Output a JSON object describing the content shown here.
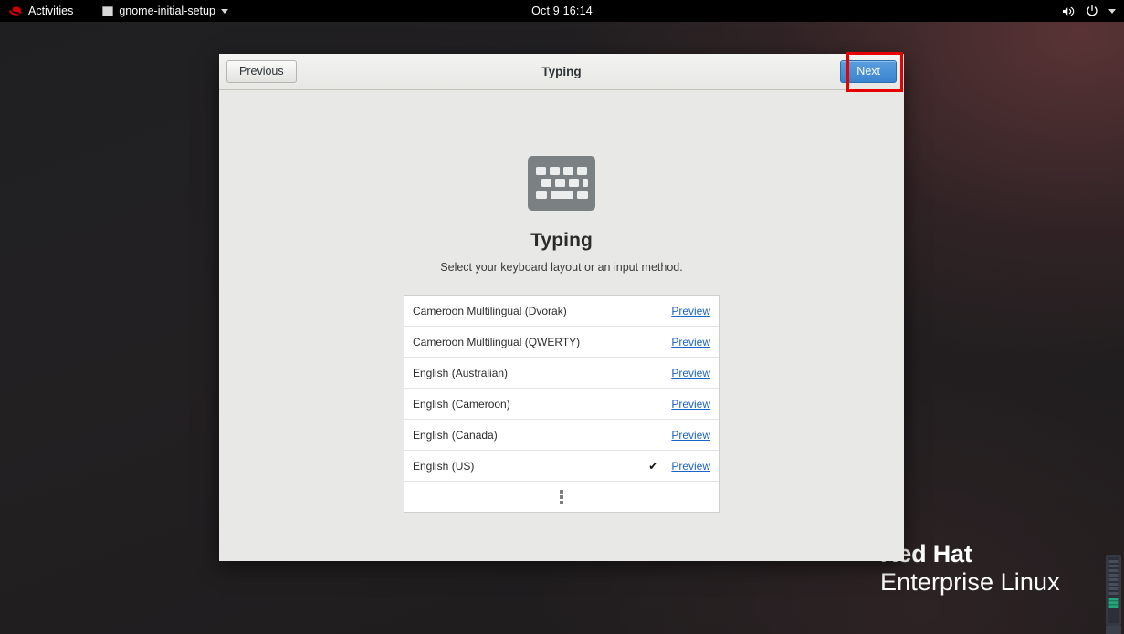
{
  "topbar": {
    "activities_label": "Activities",
    "activities_icon": "redhat-logo-icon",
    "app_name": "gnome-initial-setup",
    "clock": "Oct 9  16:14",
    "volume_icon": "volume-icon",
    "power_icon": "power-icon",
    "menu_caret_icon": "chevron-down-icon"
  },
  "dialog": {
    "title": "Typing",
    "previous_label": "Previous",
    "next_label": "Next",
    "icon": "keyboard-icon",
    "heading": "Typing",
    "subheading": "Select your keyboard layout or an input method.",
    "preview_label": "Preview",
    "selected_marker": "✔",
    "more_label": "More…"
  },
  "layouts": [
    {
      "name": "Cameroon Multilingual (Dvorak)",
      "selected": false
    },
    {
      "name": "Cameroon Multilingual (QWERTY)",
      "selected": false
    },
    {
      "name": "English (Australian)",
      "selected": false
    },
    {
      "name": "English (Cameroon)",
      "selected": false
    },
    {
      "name": "English (Canada)",
      "selected": false
    },
    {
      "name": "English (US)",
      "selected": true
    }
  ],
  "branding": {
    "line1": "Red Hat",
    "line2": "Enterprise Linux"
  },
  "annotation": {
    "target": "next-button",
    "color": "#e60000"
  },
  "colors": {
    "accent_blue": "#3a84cf",
    "link_blue": "#1b64c8",
    "dialog_bg": "#e8e8e6",
    "topbar_bg": "#000000",
    "redhat_red": "#cc0000"
  }
}
